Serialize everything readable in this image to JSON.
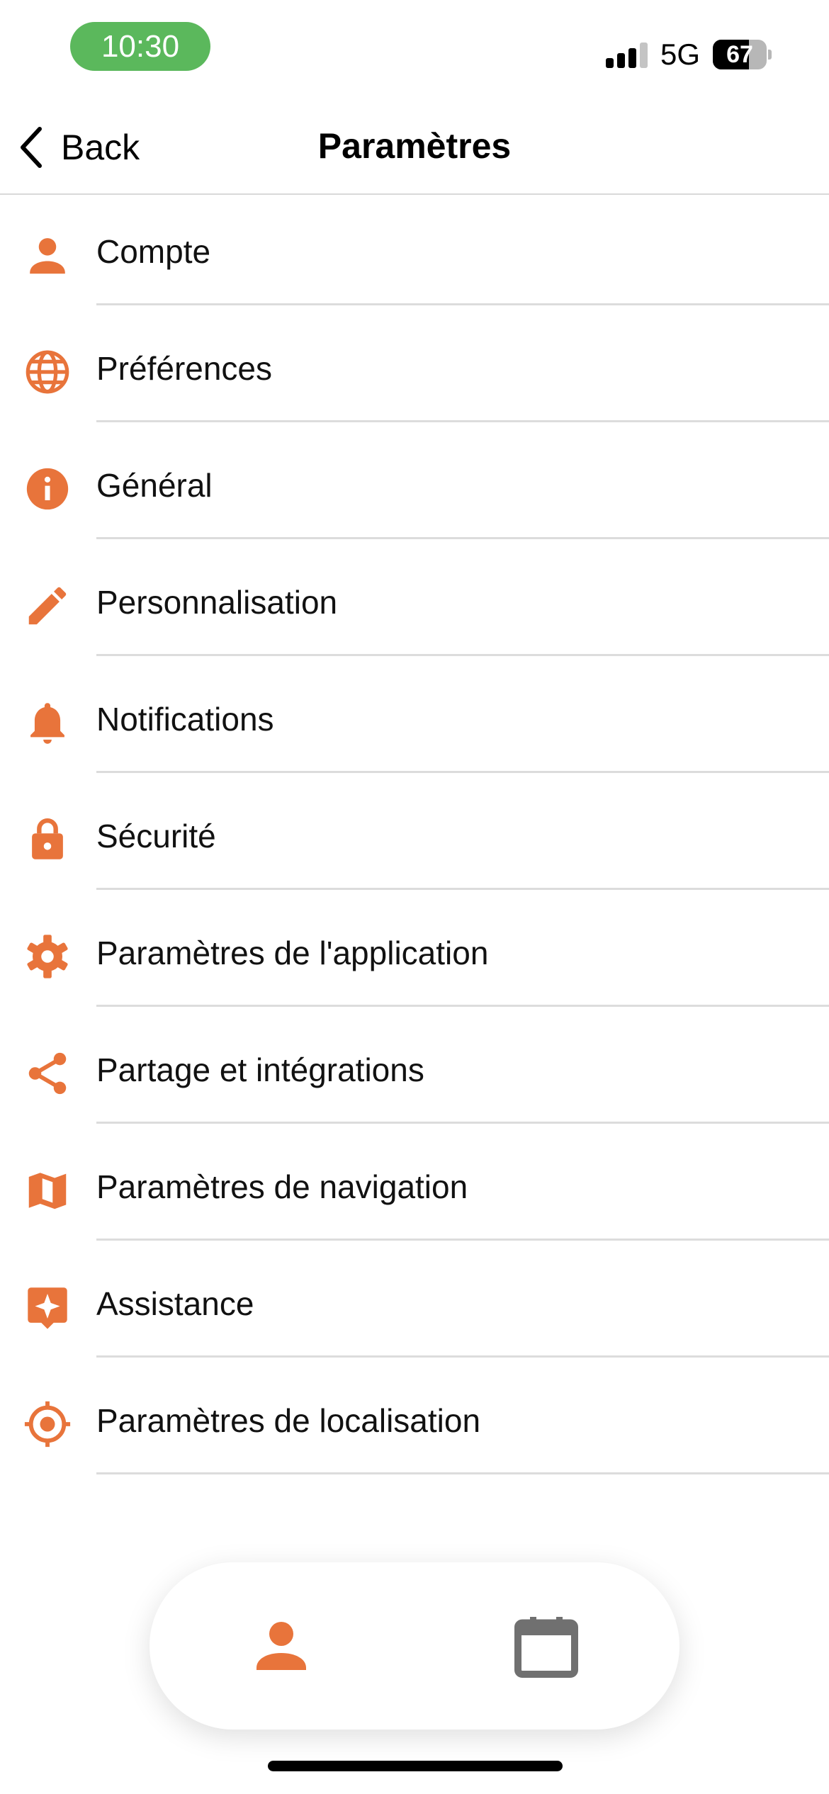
{
  "status_bar": {
    "time": "10:30",
    "network": "5G",
    "battery": "67",
    "battery_level": 0.67
  },
  "nav": {
    "back_label": "Back",
    "title": "Paramètres"
  },
  "settings": [
    {
      "label": "Compte",
      "icon": "person-icon"
    },
    {
      "label": "Préférences",
      "icon": "globe-icon"
    },
    {
      "label": "Général",
      "icon": "info-icon"
    },
    {
      "label": "Personnalisation",
      "icon": "pencil-icon"
    },
    {
      "label": "Notifications",
      "icon": "bell-icon"
    },
    {
      "label": "Sécurité",
      "icon": "lock-icon"
    },
    {
      "label": "Paramètres de l'application",
      "icon": "gear-icon"
    },
    {
      "label": "Partage et intégrations",
      "icon": "share-icon"
    },
    {
      "label": "Paramètres de navigation",
      "icon": "map-icon"
    },
    {
      "label": "Assistance",
      "icon": "sparkle-icon"
    },
    {
      "label": "Paramètres de localisation",
      "icon": "location-target-icon"
    }
  ],
  "tab_bar": {
    "tabs": [
      {
        "icon": "person-icon",
        "active": true
      },
      {
        "icon": "calendar-icon",
        "active": false
      }
    ]
  },
  "colors": {
    "accent": "#E8743B",
    "inactive_icon": "#707070",
    "time_pill": "#5BB85C",
    "divider": "#DCDCDC"
  }
}
